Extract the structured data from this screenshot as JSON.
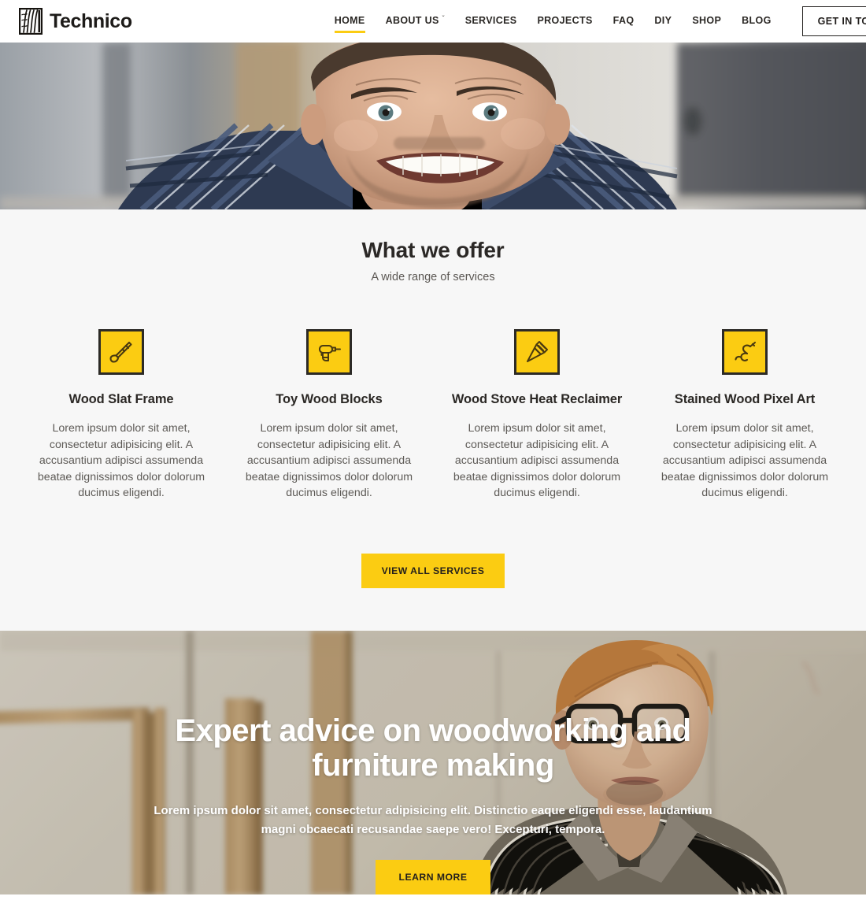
{
  "brand": {
    "name": "Technico",
    "mark_icon": "wood-grain-logo-icon"
  },
  "nav": {
    "items": [
      {
        "label": "HOME",
        "active": true,
        "has_dropdown": false
      },
      {
        "label": "ABOUT US",
        "active": false,
        "has_dropdown": true
      },
      {
        "label": "SERVICES",
        "active": false,
        "has_dropdown": false
      },
      {
        "label": "PROJECTS",
        "active": false,
        "has_dropdown": false
      },
      {
        "label": "FAQ",
        "active": false,
        "has_dropdown": false
      },
      {
        "label": "DIY",
        "active": false,
        "has_dropdown": false
      },
      {
        "label": "SHOP",
        "active": false,
        "has_dropdown": false
      },
      {
        "label": "BLOG",
        "active": false,
        "has_dropdown": false
      }
    ],
    "cta_label": "GET IN TOUCH",
    "caret_glyph": "ˇ",
    "active_underline_color": "#fbcc12"
  },
  "hero_top": {
    "image_description": "Close-up photo of a smiling bearded man wearing a blue plaid shirt in a bright room"
  },
  "offer": {
    "title": "What we offer",
    "subtitle": "A wide range of services",
    "cta_label": "VIEW ALL SERVICES",
    "accent_color": "#fbcc12",
    "background_color": "#f7f7f7",
    "services": [
      {
        "icon": "chisel-icon",
        "title": "Wood Slat Frame",
        "text": "Lorem ipsum dolor sit amet, consectetur adipisicing elit. A accusantium adipisci assumenda beatae dignissimos dolor dolorum ducimus eligendi."
      },
      {
        "icon": "power-drill-icon",
        "title": "Toy Wood Blocks",
        "text": "Lorem ipsum dolor sit amet, consectetur adipisicing elit. A accusantium adipisci assumenda beatae dignissimos dolor dolorum ducimus eligendi."
      },
      {
        "icon": "countersink-bit-icon",
        "title": "Wood Stove Heat Reclaimer",
        "text": "Lorem ipsum dolor sit amet, consectetur adipisicing elit. A accusantium adipisci assumenda beatae dignissimos dolor dolorum ducimus eligendi."
      },
      {
        "icon": "hook-tool-icon",
        "title": "Stained Wood Pixel Art",
        "text": "Lorem ipsum dolor sit amet, consectetur adipisicing elit. A accusantium adipisci assumenda beatae dignissimos dolor dolorum ducimus eligendi."
      }
    ]
  },
  "hero_bottom": {
    "heading": "Expert advice on woodworking and furniture making",
    "paragraph": "Lorem ipsum dolor sit amet, consectetur adipisicing elit. Distinctio eaque eligendi esse, laudantium magni obcaecati recusandae saepe vero! Excepturi, tempora.",
    "cta_label": "LEARN MORE",
    "image_description": "Photo of a young man with black glasses in a striped shirt standing in a woodworking shop with lumber and wooden frames behind him"
  }
}
